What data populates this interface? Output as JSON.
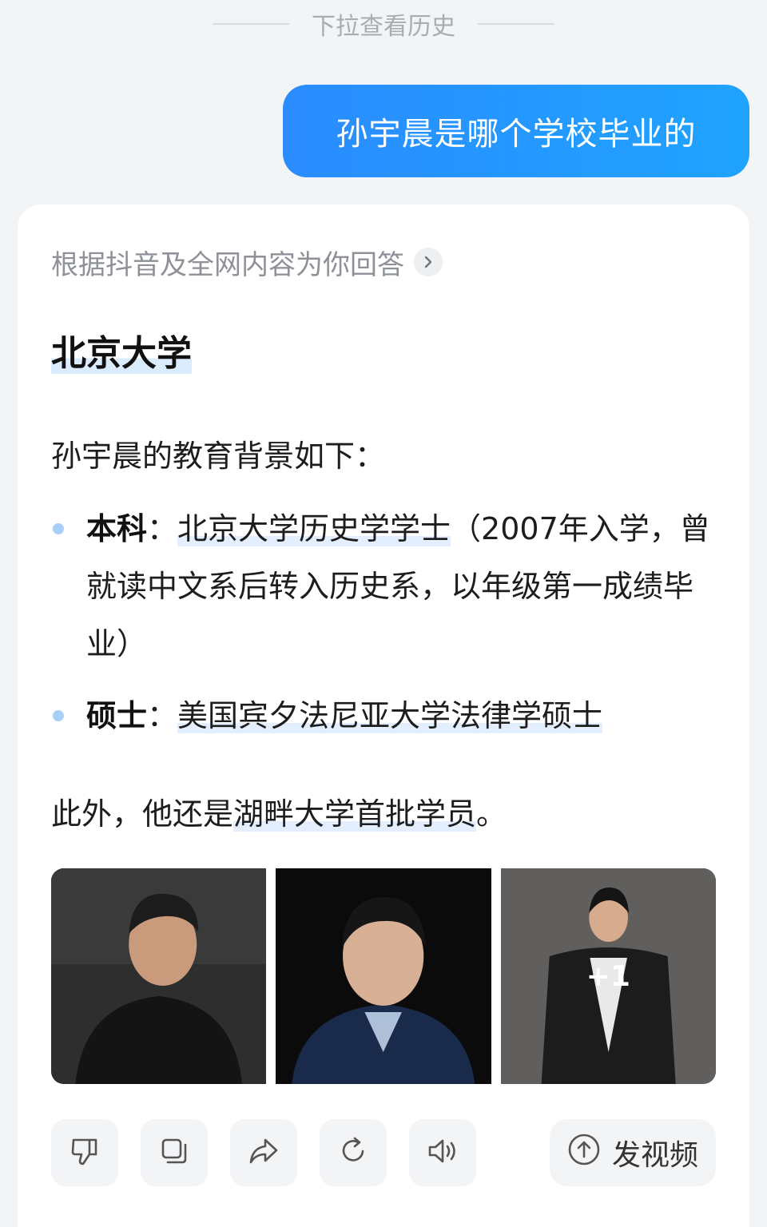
{
  "pull_hint": "下拉查看历史",
  "user_message": "孙宇晨是哪个学校毕业的",
  "answer": {
    "source_label": "根据抖音及全网内容为你回答",
    "headline": "北京大学",
    "intro": "孙宇晨的教育背景如下：",
    "bullets": [
      {
        "label": "本科",
        "colon": "：",
        "highlight": "北京大学历史学学士",
        "rest": "（2007年入学，曾就读中文系后转入历史系，以年级第一成绩毕业）"
      },
      {
        "label": "硕士",
        "colon": "：",
        "highlight": "美国宾夕法尼亚大学法律学硕士",
        "rest": ""
      }
    ],
    "extra_prefix": "此外，他还是",
    "extra_highlight": "湖畔大学首批学员",
    "extra_suffix": "。",
    "more_photos_badge": "+1",
    "video_button_label": "发视频"
  },
  "icons": {
    "source_more": "chevron-right-icon",
    "dislike": "thumb-down-icon",
    "copy": "copy-icon",
    "share": "share-icon",
    "regenerate": "refresh-icon",
    "read_aloud": "speaker-icon",
    "upload": "arrow-up-circle-icon"
  },
  "colors": {
    "bubble": "#2a8cff",
    "highlight": "#dcecff",
    "bullet_dot": "#a7cff8"
  }
}
